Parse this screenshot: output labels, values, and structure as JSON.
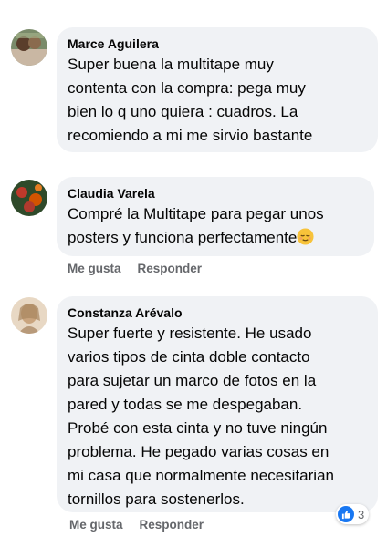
{
  "colors": {
    "bubble": "#f0f2f5",
    "action_text": "#65676b",
    "like_blue": "#1877f2"
  },
  "comments": [
    {
      "author": "Marce Aguilera",
      "text": "Super buena la multitape muy\ncontenta con la compra: pega muy\nbien lo q uno quiera : cuadros. La\nrecomiendo a mi me sirvio bastante",
      "avatar_icon": "profile-photo"
    },
    {
      "author": "Claudia Varela",
      "text": "Compré la Multitape para pegar unos\nposters y funciona perfectamente",
      "emoji": "relieved-face-emoji",
      "like_label": "Me gusta",
      "reply_label": "Responder",
      "avatar_icon": "profile-photo"
    },
    {
      "author": "Constanza Arévalo",
      "text": "Super fuerte y resistente. He usado\nvarios tipos de cinta doble contacto\npara sujetar un marco de fotos en la\npared y todas se me despegaban.\nProbé con esta cinta y no tuve ningún\nproblema. He pegado varias cosas en\nmi casa que normalmente necesitarian\ntornillos para sostenerlos.",
      "reaction_icon": "thumbs-up-icon",
      "reaction_count": "3",
      "like_label": "Me gusta",
      "reply_label": "Responder",
      "avatar_icon": "profile-photo"
    }
  ]
}
